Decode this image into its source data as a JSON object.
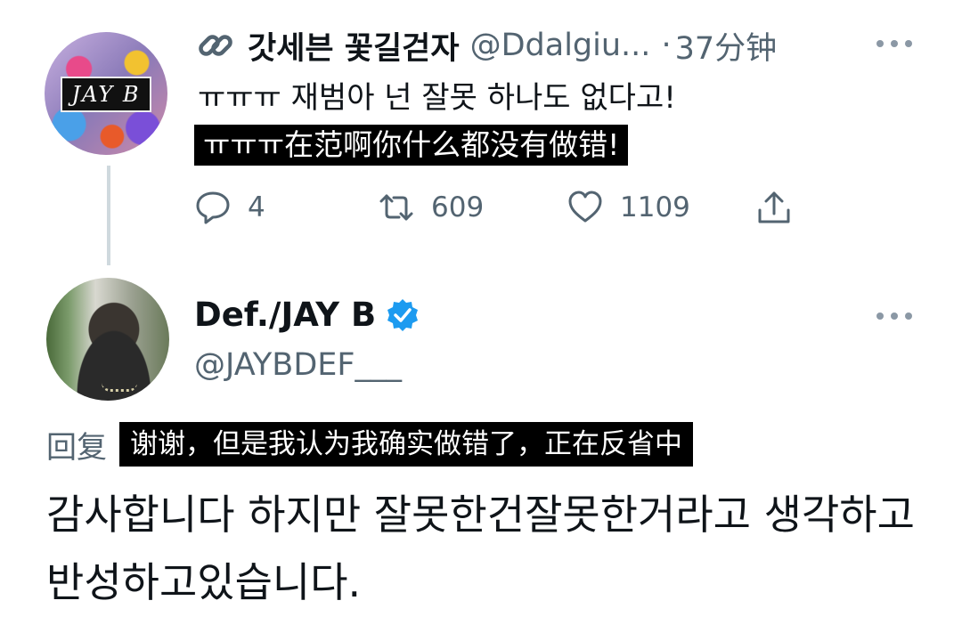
{
  "thread": {
    "tweet1": {
      "display_name": "갓세븐 꽃길걷자",
      "handle": "@Ddalgiu...",
      "separator": "·",
      "time": "37分钟",
      "text_ko": "ㅠㅠㅠ 재범아 넌 잘못 하나도 없다고!",
      "text_zh": "ㅠㅠㅠ在范啊你什么都没有做错!",
      "reply_count": "4",
      "retweet_count": "609",
      "like_count": "1109"
    },
    "tweet2": {
      "display_name": "Def./JAY B",
      "handle": "@JAYBDEF___",
      "verified": true,
      "reply_label": "回复",
      "text_zh": "谢谢，但是我认为我确实做错了，正在反省中",
      "text_ko": "감사합니다 하지만 잘못한건잘못한거라고 생각하고 반성하고있습니다."
    }
  },
  "avatar1_text": "JAY B",
  "icons": {
    "link": "link-icon",
    "more": "more-horizontal-icon",
    "reply": "reply-icon",
    "retweet": "retweet-icon",
    "like": "heart-icon",
    "share": "share-icon",
    "verified": "verified-badge-icon"
  },
  "colors": {
    "text": "#0f1419",
    "secondary": "#536471",
    "verified": "#1d9bf0",
    "caption_bg": "#000000",
    "thread_line": "#cfd9de"
  }
}
